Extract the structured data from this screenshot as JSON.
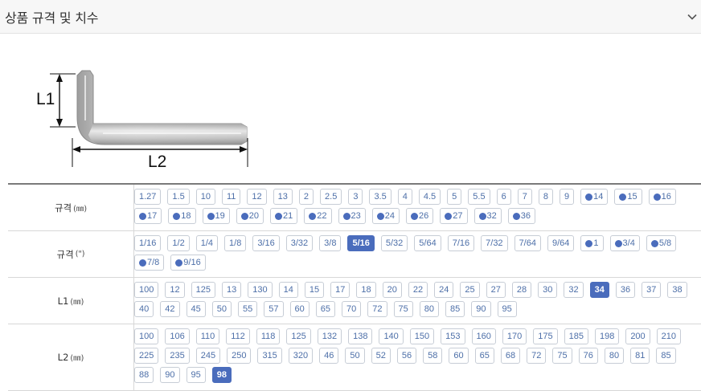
{
  "header": {
    "title": "상품 규격 및 치수",
    "toggle_icon": "chevron-down-icon"
  },
  "diagram": {
    "label_l1": "L1",
    "label_l2": "L2",
    "image_icon": "hex-key-wrench-icon"
  },
  "colors": {
    "chip_text": "#4d6fa8",
    "chip_selected_bg": "#4a6cbc",
    "chip_border": "#c7cdd6"
  },
  "rows": [
    {
      "label": "규격",
      "unit": "(㎜)",
      "values": [
        {
          "text": "1.27"
        },
        {
          "text": "1.5"
        },
        {
          "text": "10"
        },
        {
          "text": "11"
        },
        {
          "text": "12"
        },
        {
          "text": "13"
        },
        {
          "text": "2"
        },
        {
          "text": "2.5"
        },
        {
          "text": "3"
        },
        {
          "text": "3.5"
        },
        {
          "text": "4"
        },
        {
          "text": "4.5"
        },
        {
          "text": "5"
        },
        {
          "text": "5.5"
        },
        {
          "text": "6"
        },
        {
          "text": "7"
        },
        {
          "text": "8"
        },
        {
          "text": "9"
        },
        {
          "text": "14",
          "dot": true
        },
        {
          "text": "15",
          "dot": true
        },
        {
          "text": "16",
          "dot": true
        },
        {
          "text": "17",
          "dot": true
        },
        {
          "text": "18",
          "dot": true
        },
        {
          "text": "19",
          "dot": true
        },
        {
          "text": "20",
          "dot": true
        },
        {
          "text": "21",
          "dot": true
        },
        {
          "text": "22",
          "dot": true
        },
        {
          "text": "23",
          "dot": true
        },
        {
          "text": "24",
          "dot": true
        },
        {
          "text": "26",
          "dot": true
        },
        {
          "text": "27",
          "dot": true
        },
        {
          "text": "32",
          "dot": true
        },
        {
          "text": "36",
          "dot": true
        }
      ]
    },
    {
      "label": "규격",
      "unit": "(\")",
      "values": [
        {
          "text": "1/16"
        },
        {
          "text": "1/2"
        },
        {
          "text": "1/4"
        },
        {
          "text": "1/8"
        },
        {
          "text": "3/16"
        },
        {
          "text": "3/32"
        },
        {
          "text": "3/8"
        },
        {
          "text": "5/16",
          "selected": true
        },
        {
          "text": "5/32"
        },
        {
          "text": "5/64"
        },
        {
          "text": "7/16"
        },
        {
          "text": "7/32"
        },
        {
          "text": "7/64"
        },
        {
          "text": "9/64"
        },
        {
          "text": "1",
          "dot": true
        },
        {
          "text": "3/4",
          "dot": true
        },
        {
          "text": "5/8",
          "dot": true
        },
        {
          "text": "7/8",
          "dot": true
        },
        {
          "text": "9/16",
          "dot": true
        }
      ]
    },
    {
      "label": "L1",
      "unit": "(㎜)",
      "values": [
        {
          "text": "100"
        },
        {
          "text": "12"
        },
        {
          "text": "125"
        },
        {
          "text": "13"
        },
        {
          "text": "130"
        },
        {
          "text": "14"
        },
        {
          "text": "15"
        },
        {
          "text": "17"
        },
        {
          "text": "18"
        },
        {
          "text": "20"
        },
        {
          "text": "22"
        },
        {
          "text": "24"
        },
        {
          "text": "25"
        },
        {
          "text": "27"
        },
        {
          "text": "28"
        },
        {
          "text": "30"
        },
        {
          "text": "32"
        },
        {
          "text": "34",
          "selected": true
        },
        {
          "text": "36"
        },
        {
          "text": "37"
        },
        {
          "text": "38"
        },
        {
          "text": "40"
        },
        {
          "text": "42"
        },
        {
          "text": "45"
        },
        {
          "text": "50"
        },
        {
          "text": "55"
        },
        {
          "text": "57"
        },
        {
          "text": "60"
        },
        {
          "text": "65"
        },
        {
          "text": "70"
        },
        {
          "text": "72"
        },
        {
          "text": "75"
        },
        {
          "text": "80"
        },
        {
          "text": "85"
        },
        {
          "text": "90"
        },
        {
          "text": "95"
        }
      ]
    },
    {
      "label": "L2",
      "unit": "(㎜)",
      "values": [
        {
          "text": "100"
        },
        {
          "text": "106"
        },
        {
          "text": "110"
        },
        {
          "text": "112"
        },
        {
          "text": "118"
        },
        {
          "text": "125"
        },
        {
          "text": "132"
        },
        {
          "text": "138"
        },
        {
          "text": "140"
        },
        {
          "text": "150"
        },
        {
          "text": "153"
        },
        {
          "text": "160"
        },
        {
          "text": "170"
        },
        {
          "text": "175"
        },
        {
          "text": "185"
        },
        {
          "text": "198"
        },
        {
          "text": "200"
        },
        {
          "text": "210"
        },
        {
          "text": "225"
        },
        {
          "text": "235"
        },
        {
          "text": "245"
        },
        {
          "text": "250"
        },
        {
          "text": "315"
        },
        {
          "text": "320"
        },
        {
          "text": "46"
        },
        {
          "text": "50"
        },
        {
          "text": "52"
        },
        {
          "text": "56"
        },
        {
          "text": "58"
        },
        {
          "text": "60"
        },
        {
          "text": "65"
        },
        {
          "text": "68"
        },
        {
          "text": "72"
        },
        {
          "text": "75"
        },
        {
          "text": "76"
        },
        {
          "text": "80"
        },
        {
          "text": "81"
        },
        {
          "text": "85"
        },
        {
          "text": "88"
        },
        {
          "text": "90"
        },
        {
          "text": "95"
        },
        {
          "text": "98",
          "selected": true
        }
      ]
    }
  ]
}
